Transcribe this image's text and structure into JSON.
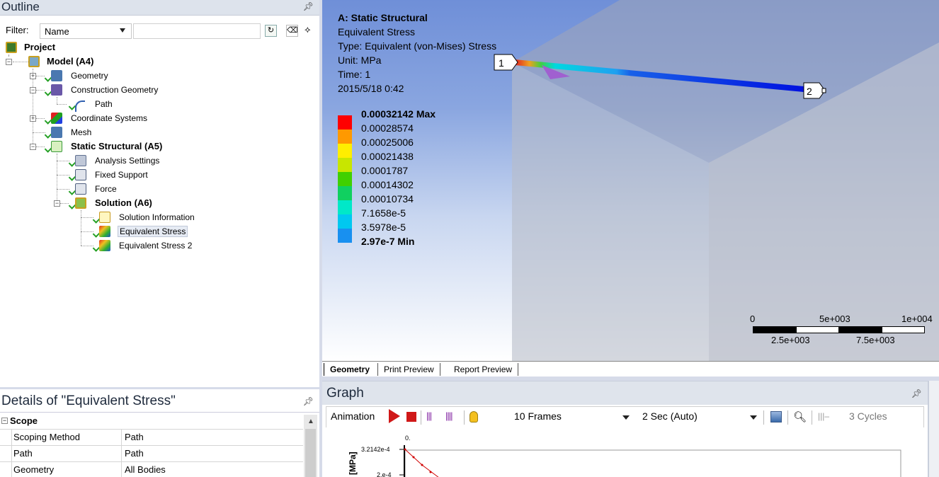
{
  "outline": {
    "title": "Outline",
    "pin": "ᵖ",
    "filter_label": "Filter:",
    "filter_value": "Name",
    "filter_text": "",
    "tree": [
      {
        "label": "Project",
        "bold": true
      },
      {
        "label": "Model (A4)",
        "bold": true
      },
      {
        "label": "Geometry"
      },
      {
        "label": "Construction Geometry"
      },
      {
        "label": "Path"
      },
      {
        "label": "Coordinate Systems"
      },
      {
        "label": "Mesh"
      },
      {
        "label": "Static Structural (A5)",
        "bold": true
      },
      {
        "label": "Analysis Settings"
      },
      {
        "label": "Fixed Support"
      },
      {
        "label": "Force"
      },
      {
        "label": "Solution (A6)",
        "bold": true
      },
      {
        "label": "Solution Information"
      },
      {
        "label": "Equivalent Stress",
        "selected": true
      },
      {
        "label": "Equivalent Stress 2"
      }
    ]
  },
  "details": {
    "title": "Details of \"Equivalent Stress\"",
    "section": "Scope",
    "rows": [
      {
        "name": "Scoping Method",
        "value": "Path"
      },
      {
        "name": "Path",
        "value": "Path"
      },
      {
        "name": "Geometry",
        "value": "All Bodies"
      }
    ]
  },
  "viewport": {
    "info": {
      "analysis": "A: Static Structural",
      "result": "Equivalent Stress",
      "type": "Type: Equivalent (von-Mises) Stress",
      "unit": "Unit: MPa",
      "time": "Time: 1",
      "date": "2015/5/18 0:42"
    },
    "legend": [
      {
        "label": "0.00032142 Max",
        "color": "#ff0000",
        "bold": true
      },
      {
        "label": "0.00028574",
        "color": "#ff9900"
      },
      {
        "label": "0.00025006",
        "color": "#ffee00"
      },
      {
        "label": "0.00021438",
        "color": "#c8e600"
      },
      {
        "label": "0.0001787",
        "color": "#40d000"
      },
      {
        "label": "0.00014302",
        "color": "#10d060"
      },
      {
        "label": "0.00010734",
        "color": "#00e8c8"
      },
      {
        "label": "7.1658e-5",
        "color": "#00c8f0"
      },
      {
        "label": "3.5978e-5",
        "color": "#1890f0"
      },
      {
        "label": "2.97e-7 Min",
        "color": "#0010e8",
        "bold": true
      }
    ],
    "probe_1": "1",
    "probe_2": "2",
    "scale": {
      "top_0": "0",
      "top_mid": "5e+003",
      "top_end": "1e+004",
      "bot_a": "2.5e+003",
      "bot_b": "7.5e+003"
    },
    "tabs": [
      "Geometry",
      "Print Preview",
      "Report Preview"
    ]
  },
  "graph": {
    "title": "Graph",
    "animation_label": "Animation",
    "frames": "10 Frames",
    "duration": "2 Sec (Auto)",
    "cycles": "3 Cycles",
    "y_top_label": "3.2142e-4",
    "y_next_label": "2.e-4",
    "x_zero_label": "0.",
    "axis_unit": "[MPa]"
  }
}
